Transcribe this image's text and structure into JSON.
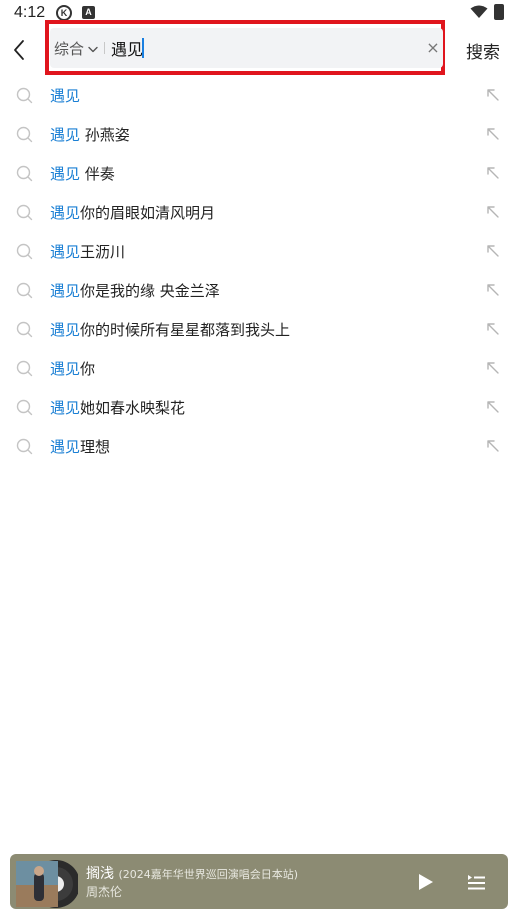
{
  "status_bar": {
    "time": "4:12",
    "k_badge": "K",
    "a_badge": "A",
    "icons": [
      "k-circle-icon",
      "a-square-icon",
      "wifi-icon",
      "battery-icon"
    ]
  },
  "header": {
    "back_icon": "chevron-left-icon",
    "scope_label": "综合",
    "query": "遇见",
    "clear_label": "×",
    "search_label": "搜索",
    "highlight_color": "#e0151d"
  },
  "suggestions": [
    {
      "highlight": "遇见",
      "rest": ""
    },
    {
      "highlight": "遇见",
      "rest": " 孙燕姿"
    },
    {
      "highlight": "遇见",
      "rest": " 伴奏"
    },
    {
      "highlight": "遇见",
      "rest": "你的眉眼如清风明月"
    },
    {
      "highlight": "遇见",
      "rest": "王沥川"
    },
    {
      "highlight": "遇见",
      "rest": "你是我的缘 央金兰泽"
    },
    {
      "highlight": "遇见",
      "rest": "你的时候所有星星都落到我头上"
    },
    {
      "highlight": "遇见",
      "rest": "你"
    },
    {
      "highlight": "遇见",
      "rest": "她如春水映梨花"
    },
    {
      "highlight": "遇见",
      "rest": "理想"
    }
  ],
  "player": {
    "title": "搁浅",
    "subtitle": "(2024嘉年华世界巡回演唱会日本站)",
    "artist": "周杰伦",
    "background": "#8c8b73",
    "icons": [
      "play-icon",
      "playlist-icon"
    ]
  }
}
